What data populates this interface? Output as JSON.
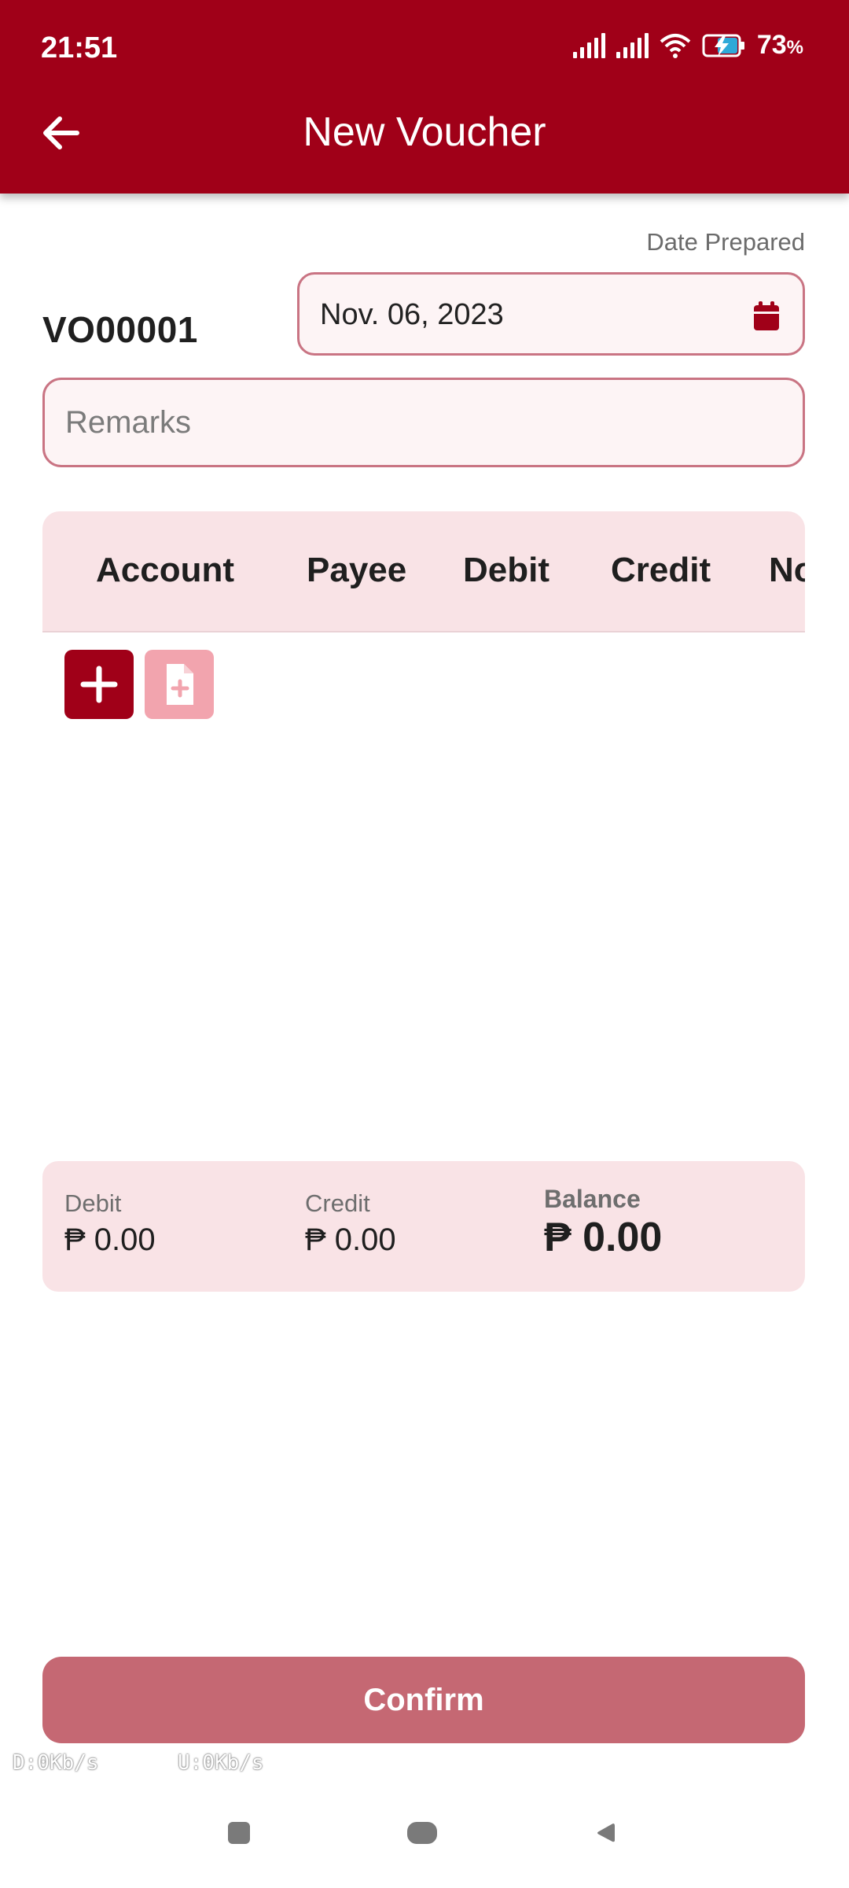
{
  "status_bar": {
    "time": "21:51",
    "battery_percent": "73",
    "battery_unit": "%",
    "icons": [
      "signal-icon",
      "signal-icon",
      "wifi-icon",
      "battery-charging-icon"
    ]
  },
  "appbar": {
    "title": "New Voucher",
    "back_icon": "arrow-left-icon"
  },
  "form": {
    "voucher_number": "VO00001",
    "date_label": "Date Prepared",
    "date_value": "Nov. 06, 2023",
    "date_icon": "calendar-icon",
    "remarks_placeholder": "Remarks",
    "remarks_value": ""
  },
  "table": {
    "columns": [
      "Account",
      "Payee",
      "Debit",
      "Credit",
      "No"
    ],
    "rows": [],
    "add_icon": "plus-icon",
    "attach_icon": "file-add-icon"
  },
  "totals": {
    "debit_label": "Debit",
    "debit_value": "₱ 0.00",
    "credit_label": "Credit",
    "credit_value": "₱ 0.00",
    "balance_label": "Balance",
    "balance_value": "₱ 0.00"
  },
  "actions": {
    "confirm_label": "Confirm"
  },
  "network_overlay": {
    "down": "D:0Kb/s",
    "up": "U:0Kb/s"
  },
  "colors": {
    "primary": "#a00018",
    "primary_light": "#f9e3e6",
    "confirm": "#c56873",
    "field_border": "#c97483"
  }
}
